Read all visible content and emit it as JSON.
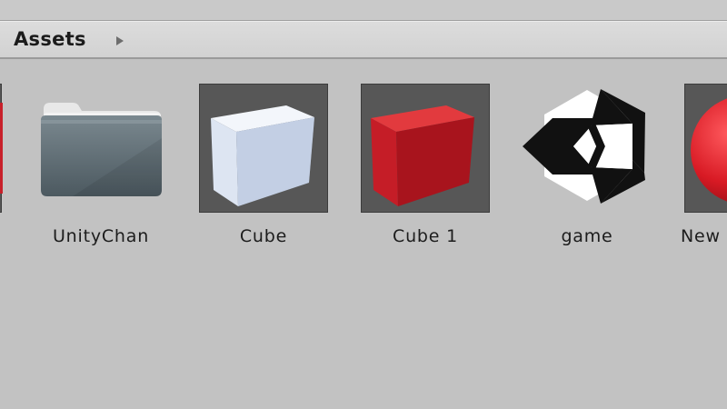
{
  "breadcrumb": {
    "root_label": "Assets",
    "arrow_icon": "triangle-right-icon"
  },
  "assets": [
    {
      "name": "",
      "icon": "material-red-icon"
    },
    {
      "name": "UnityChan",
      "icon": "folder-icon"
    },
    {
      "name": "Cube",
      "icon": "prefab-cube-white-icon"
    },
    {
      "name": "Cube 1",
      "icon": "prefab-cube-red-icon"
    },
    {
      "name": "game",
      "icon": "unity-scene-icon"
    },
    {
      "name": "New",
      "icon": "material-sphere-red-icon"
    }
  ],
  "colors": {
    "panel_bg": "#c2c2c2",
    "thumb_bg": "#575757",
    "cube_white": "#dfe6f2",
    "cube_red": "#c8202a",
    "folder": "#5c6a72"
  }
}
